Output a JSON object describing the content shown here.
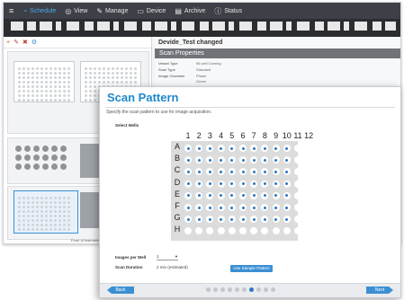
{
  "topbar": {
    "items": [
      {
        "label": "Schedule",
        "icon": "schedule-icon",
        "active": true
      },
      {
        "label": "View",
        "icon": "eye-icon",
        "active": false
      },
      {
        "label": "Manage",
        "icon": "manage-icon",
        "active": false
      },
      {
        "label": "Device",
        "icon": "device-icon",
        "active": false
      },
      {
        "label": "Archive",
        "icon": "archive-icon",
        "active": false
      },
      {
        "label": "Status",
        "icon": "status-icon",
        "active": false
      }
    ]
  },
  "left_pane": {
    "footer_label": "Front of Instrument"
  },
  "right_pane": {
    "protocol_title": "Devide_Test changed",
    "section_header": "Scan Properties",
    "properties": [
      {
        "label": "Vessel Type",
        "value": "96 well Corning"
      },
      {
        "label": "Scan Type",
        "value": "Standard"
      },
      {
        "label": "Image Channels",
        "value": "Phase"
      },
      {
        "label": "",
        "value": "Green"
      }
    ]
  },
  "dialog": {
    "title": "Scan Pattern",
    "description": "Specify the scan pattern to use for image acquisition.",
    "select_wells_label": "Select Wells",
    "plate": {
      "columns": [
        "1",
        "2",
        "3",
        "4",
        "5",
        "6",
        "7",
        "8",
        "9",
        "10",
        "11",
        "12"
      ],
      "rows": [
        "A",
        "B",
        "C",
        "D",
        "E",
        "F",
        "G",
        "H"
      ],
      "selected_rows": [
        "A",
        "B",
        "C",
        "D",
        "E",
        "F",
        "G"
      ],
      "selected_columns": [
        "1",
        "2",
        "3",
        "4",
        "5",
        "6",
        "7",
        "8",
        "9",
        "10"
      ]
    },
    "images_per_well_label": "Images per Well",
    "images_per_well_value": "1",
    "scan_duration_label": "Scan Duration",
    "scan_duration_value": "2 min (estimated)",
    "use_sample_button": "Use Sample Pattern",
    "back_button": "Back",
    "next_button": "Next",
    "pager": {
      "total": 10,
      "current": 7
    },
    "colors": {
      "accent": "#1e88c9",
      "button": "#3b8fd3",
      "selected_dot": "#2b78c2",
      "plate_bg": "#dcdcdc"
    }
  }
}
